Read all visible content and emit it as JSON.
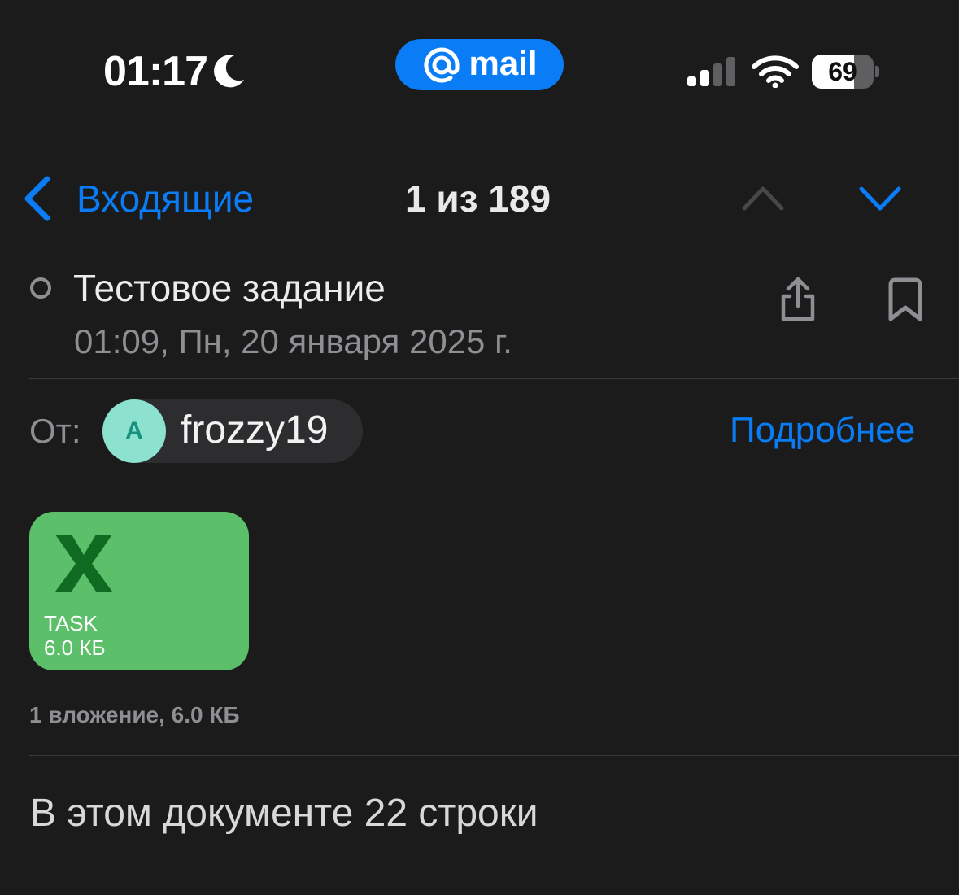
{
  "status_bar": {
    "time": "01:17",
    "focus_icon": "moon-icon",
    "app_badge": {
      "at_symbol": "@",
      "label": "mail",
      "color": "#0a7cf5"
    },
    "signal_bars_active": 2,
    "signal_bars_total": 4,
    "battery_level": "69",
    "battery_fraction": 0.69
  },
  "nav": {
    "back_label": "Входящие",
    "counter": "1 из 189",
    "accent_color": "#0a7cf5"
  },
  "message": {
    "subject": "Тестовое задание",
    "date": "01:09, Пн, 20 января 2025 г.",
    "from_label": "От:",
    "sender_initial": "A",
    "sender_name": "frozzy19",
    "details_link": "Подробнее",
    "attachment": {
      "name": "TASK",
      "size": "6.0 КБ",
      "icon": "excel-icon",
      "card_color": "#5cbf69"
    },
    "attachments_summary": "1 вложение, 6.0 КБ",
    "body": "В этом документе 22 строки"
  }
}
